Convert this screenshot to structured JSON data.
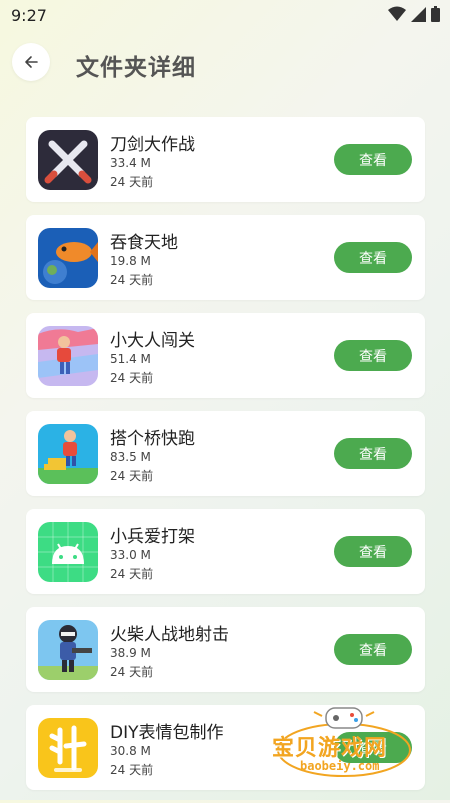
{
  "status_bar": {
    "time": "9:27",
    "icons": [
      "wifi-icon",
      "signal-icon",
      "battery-icon"
    ]
  },
  "header": {
    "title": "文件夹详细",
    "back_icon": "back-arrow-icon"
  },
  "apps": [
    {
      "name": "刀剑大作战",
      "size": "33.4 M",
      "date": "24 天前",
      "button": "查看",
      "icon": "crossed-swords-icon"
    },
    {
      "name": "吞食天地",
      "size": "19.8 M",
      "date": "24 天前",
      "button": "查看",
      "icon": "fish-planet-icon"
    },
    {
      "name": "小大人闯关",
      "size": "51.4 M",
      "date": "24 天前",
      "button": "查看",
      "icon": "runner-game-icon"
    },
    {
      "name": "搭个桥快跑",
      "size": "83.5 M",
      "date": "24 天前",
      "button": "查看",
      "icon": "bridge-runner-icon"
    },
    {
      "name": "小兵爱打架",
      "size": "33.0 M",
      "date": "24 天前",
      "button": "查看",
      "icon": "android-icon"
    },
    {
      "name": "火柴人战地射击",
      "size": "38.9 M",
      "date": "24 天前",
      "button": "查看",
      "icon": "stickman-shooter-icon"
    },
    {
      "name": "DIY表情包制作",
      "size": "30.8 M",
      "date": "24 天前",
      "button": "查看",
      "icon": "diy-emoji-icon"
    }
  ],
  "watermark": {
    "text": "宝贝游戏网",
    "domain": "baobeiy.com"
  },
  "colors": {
    "accent": "#4caa4f",
    "card": "#ffffff",
    "title": "#555555"
  }
}
